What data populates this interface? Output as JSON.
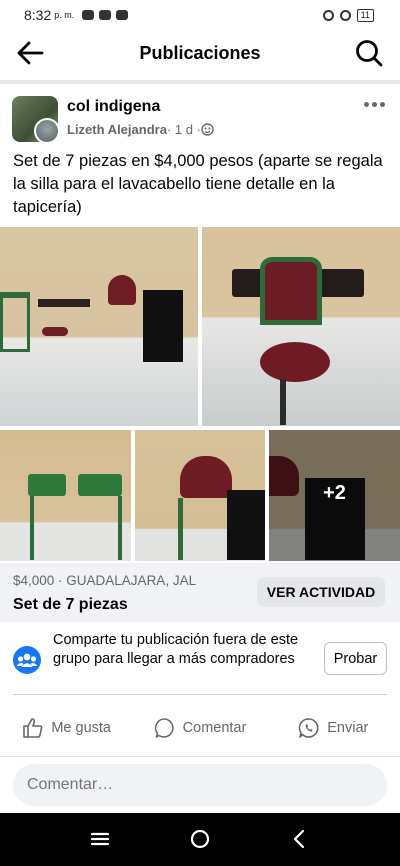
{
  "status_bar": {
    "time": "8:32",
    "ampm": "p. m.",
    "battery": "11"
  },
  "header": {
    "title": "Publicaciones"
  },
  "post": {
    "group_name": "col indigena",
    "author": "Lizeth Alejandra",
    "time": " · 1 d · ",
    "text": "Set de 7 piezas en $4,000 pesos (aparte se regala la silla para el lavacabello tiene detalle en la tapicería)",
    "more_photos": "+2"
  },
  "listing": {
    "price_location": "$4,000 · GUADALAJARA, JAL",
    "title": "Set de 7 piezas",
    "activity_button": "VER ACTIVIDAD"
  },
  "share": {
    "text": "Comparte tu publicación fuera de este grupo para llegar a más compradores",
    "button": "Probar"
  },
  "actions": {
    "like": "Me gusta",
    "comment": "Comentar",
    "send": "Enviar"
  },
  "comment_input": {
    "placeholder": "Comentar…"
  },
  "colors": {
    "accent": "#1877f2",
    "secondary_text": "#65676b",
    "listing_bg": "#f0f2f5"
  },
  "icons": [
    "back-arrow-icon",
    "search-icon",
    "more-options-icon",
    "globe-privacy-icon",
    "group-share-icon",
    "like-icon",
    "comment-icon",
    "whatsapp-icon",
    "nav-menu-icon",
    "nav-home-icon",
    "nav-back-icon"
  ]
}
